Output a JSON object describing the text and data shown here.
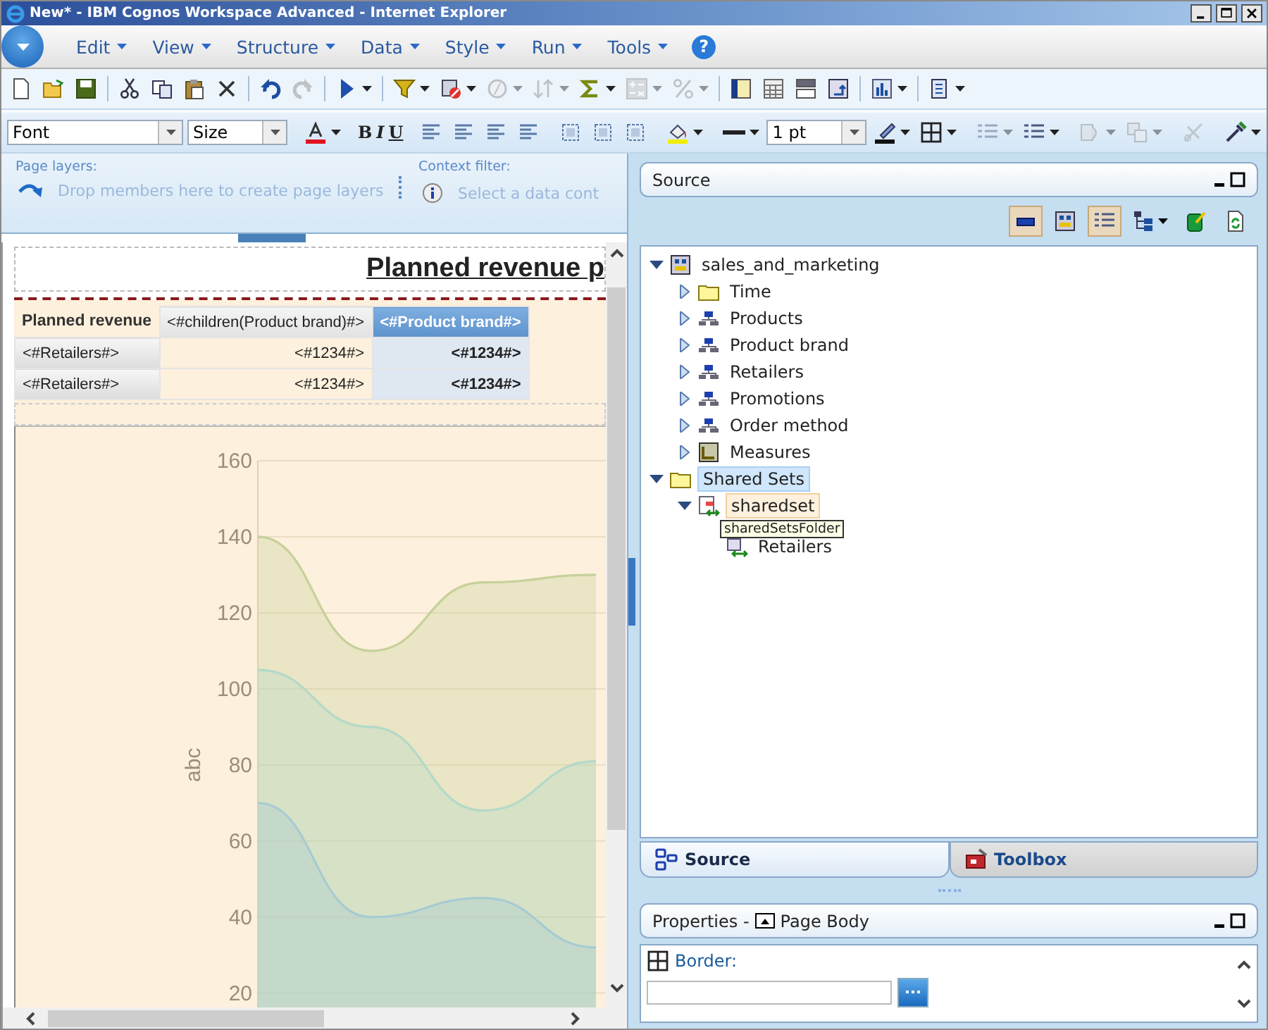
{
  "window": {
    "title": "New* - IBM Cognos Workspace Advanced - Internet Explorer"
  },
  "menu": [
    {
      "label": "Edit"
    },
    {
      "label": "View"
    },
    {
      "label": "Structure"
    },
    {
      "label": "Data"
    },
    {
      "label": "Style"
    },
    {
      "label": "Run"
    },
    {
      "label": "Tools"
    }
  ],
  "help": {
    "label": "?"
  },
  "toolbar": [
    {
      "kind": "new",
      "disabled": false,
      "dropdown": false
    },
    {
      "kind": "open",
      "disabled": false,
      "dropdown": false
    },
    {
      "kind": "save",
      "disabled": false,
      "dropdown": false
    },
    {
      "kind": "separator"
    },
    {
      "kind": "cut",
      "disabled": false,
      "dropdown": false
    },
    {
      "kind": "copy",
      "disabled": false,
      "dropdown": false
    },
    {
      "kind": "paste",
      "disabled": false,
      "dropdown": false
    },
    {
      "kind": "delete",
      "disabled": false,
      "dropdown": false
    },
    {
      "kind": "separator"
    },
    {
      "kind": "undo",
      "disabled": false,
      "dropdown": false
    },
    {
      "kind": "redo",
      "disabled": true,
      "dropdown": false
    },
    {
      "kind": "separator"
    },
    {
      "kind": "run",
      "disabled": false,
      "dropdown": true
    },
    {
      "kind": "separator"
    },
    {
      "kind": "filter",
      "disabled": false,
      "dropdown": true
    },
    {
      "kind": "suppress",
      "disabled": false,
      "dropdown": true
    },
    {
      "kind": "circle",
      "disabled": true,
      "dropdown": true
    },
    {
      "kind": "sort",
      "disabled": true,
      "dropdown": true
    },
    {
      "kind": "sigma",
      "disabled": false,
      "dropdown": true
    },
    {
      "kind": "calc",
      "disabled": true,
      "dropdown": true
    },
    {
      "kind": "percent",
      "disabled": true,
      "dropdown": true
    },
    {
      "kind": "separator"
    },
    {
      "kind": "columns",
      "disabled": false,
      "dropdown": false
    },
    {
      "kind": "grid",
      "disabled": false,
      "dropdown": false
    },
    {
      "kind": "section",
      "disabled": false,
      "dropdown": false
    },
    {
      "kind": "swap",
      "disabled": false,
      "dropdown": false
    },
    {
      "kind": "separator"
    },
    {
      "kind": "chart",
      "disabled": false,
      "dropdown": true
    },
    {
      "kind": "separator"
    },
    {
      "kind": "insert",
      "disabled": false,
      "dropdown": true
    }
  ],
  "format_toolbar": [
    {
      "kind": "select",
      "value": "Font",
      "wide": true
    },
    {
      "kind": "select",
      "value": "Size",
      "wide": false
    },
    {
      "kind": "separator"
    },
    {
      "kind": "font-color",
      "disabled": false,
      "dropdown": true
    },
    {
      "kind": "separator"
    },
    {
      "kind": "bold",
      "label": "B"
    },
    {
      "kind": "italic",
      "label": "I"
    },
    {
      "kind": "underline",
      "label": "U"
    },
    {
      "kind": "separator"
    },
    {
      "kind": "align",
      "disabled": false,
      "dropdown": false
    },
    {
      "kind": "align",
      "disabled": false,
      "dropdown": false
    },
    {
      "kind": "align",
      "disabled": false,
      "dropdown": false
    },
    {
      "kind": "align",
      "disabled": false,
      "dropdown": false
    },
    {
      "kind": "separator"
    },
    {
      "kind": "padding",
      "disabled": false,
      "dropdown": false
    },
    {
      "kind": "padding",
      "disabled": false,
      "dropdown": false
    },
    {
      "kind": "padding",
      "disabled": false,
      "dropdown": false
    },
    {
      "kind": "separator"
    },
    {
      "kind": "fill",
      "disabled": false,
      "dropdown": true
    },
    {
      "kind": "separator"
    },
    {
      "kind": "line",
      "disabled": false,
      "dropdown": true
    },
    {
      "kind": "select",
      "value": "1 pt",
      "wide": false
    },
    {
      "kind": "pen",
      "disabled": false,
      "dropdown": true
    },
    {
      "kind": "borders",
      "disabled": false,
      "dropdown": true
    },
    {
      "kind": "separator"
    },
    {
      "kind": "list",
      "disabled": true,
      "dropdown": true
    },
    {
      "kind": "list",
      "disabled": false,
      "dropdown": true
    },
    {
      "kind": "separator"
    },
    {
      "kind": "style",
      "disabled": true,
      "dropdown": true
    },
    {
      "kind": "layers",
      "disabled": true,
      "dropdown": true
    },
    {
      "kind": "separator"
    },
    {
      "kind": "scissor",
      "disabled": true,
      "dropdown": false
    },
    {
      "kind": "separator"
    },
    {
      "kind": "picker",
      "disabled": false,
      "dropdown": true
    }
  ],
  "page_layers": {
    "label": "Page layers:",
    "placeholder": "Drop members here to create page layers"
  },
  "context_filter": {
    "label": "Context filter:",
    "placeholder": "Select a data cont"
  },
  "report": {
    "title": "Planned revenue p",
    "crosstab": {
      "corner": "Planned revenue",
      "columns": [
        "<#children(Product brand)#>",
        "<#Product brand#>"
      ],
      "rows": [
        {
          "header": "<#Retailers#>",
          "cells": [
            "<#1234#>",
            "<#1234#>"
          ]
        },
        {
          "header": "<#Retailers#>",
          "cells": [
            "<#1234#>",
            "<#1234#>"
          ]
        }
      ]
    },
    "chart_data": {
      "type": "area",
      "ylabel": "abc",
      "ylim": [
        14,
        160
      ],
      "grid": true,
      "yticks": [
        20,
        40,
        60,
        80,
        100,
        120,
        140,
        160
      ],
      "series": [
        {
          "color": "#c5d19a",
          "values": [
            140,
            110,
            128,
            130
          ]
        },
        {
          "color": "#b3d9c8",
          "values": [
            105,
            90,
            68,
            81
          ]
        },
        {
          "color": "#a6cbd3",
          "values": [
            70,
            40,
            45,
            32
          ]
        }
      ]
    }
  },
  "source_panel": {
    "title": "Source",
    "tools": [
      {
        "kind": "bar",
        "selected": true
      },
      {
        "kind": "package",
        "selected": false
      },
      {
        "kind": "list",
        "selected": true
      },
      {
        "kind": "tree",
        "selected": false
      },
      {
        "kind": "edit",
        "selected": false
      },
      {
        "kind": "refresh",
        "selected": false
      }
    ],
    "tree": [
      {
        "label": "sales_and_marketing",
        "kind": "package",
        "expanded": true,
        "selected": false,
        "children": [
          {
            "label": "Time",
            "kind": "folder",
            "expanded": false,
            "selected": false
          },
          {
            "label": "Products",
            "kind": "dimension",
            "expanded": false,
            "selected": false
          },
          {
            "label": "Product brand",
            "kind": "dimension",
            "expanded": false,
            "selected": false
          },
          {
            "label": "Retailers",
            "kind": "dimension",
            "expanded": false,
            "selected": false
          },
          {
            "label": "Promotions",
            "kind": "dimension",
            "expanded": false,
            "selected": false
          },
          {
            "label": "Order method",
            "kind": "dimension",
            "expanded": false,
            "selected": false
          },
          {
            "label": "Measures",
            "kind": "measures",
            "expanded": false,
            "selected": false
          }
        ]
      },
      {
        "label": "Shared Sets",
        "kind": "folder",
        "expanded": true,
        "selected": true,
        "children": [
          {
            "label": "sharedset",
            "kind": "sharedset",
            "expanded": true,
            "selected": false,
            "hover": true,
            "children": [
              {
                "label": "Retailers",
                "kind": "set",
                "selected": false
              }
            ]
          }
        ]
      }
    ],
    "tooltip": "sharedSetsFolder"
  },
  "tabs": [
    {
      "label": "Source",
      "kind": "source",
      "selected": true
    },
    {
      "label": "Toolbox",
      "kind": "toolbox",
      "selected": false
    }
  ],
  "properties": {
    "title": "Properties - ",
    "object": "Page Body",
    "property": "Border:"
  }
}
